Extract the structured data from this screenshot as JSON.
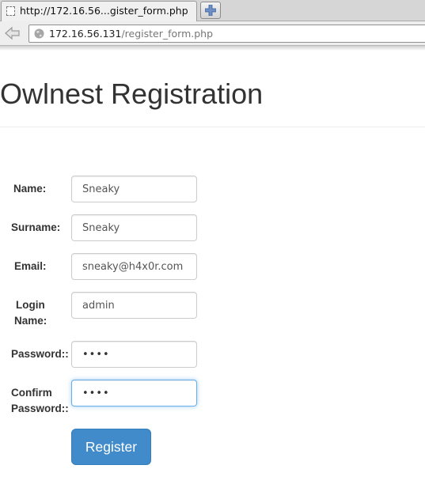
{
  "browser": {
    "tab_title": "http://172.16.56...gister_form.php",
    "url_host": "172.16.56.131",
    "url_path": "/register_form.php"
  },
  "page": {
    "title": "Owlnest Registration"
  },
  "form": {
    "name_label": "Name:",
    "name_value": "Sneaky",
    "surname_label": "Surname:",
    "surname_value": "Sneaky",
    "email_label": "Email:",
    "email_value": "sneaky@h4x0r.com",
    "login_label_line1": "Login",
    "login_label_line2": "Name:",
    "login_value": "admin",
    "password_label": "Password::",
    "password_value": "••••",
    "confirm_label_line1": "Confirm",
    "confirm_label_line2": "Password::",
    "confirm_value": "••••",
    "register_label": "Register"
  },
  "colors": {
    "primary_button": "#428bca",
    "focus_border": "#66afe9"
  }
}
